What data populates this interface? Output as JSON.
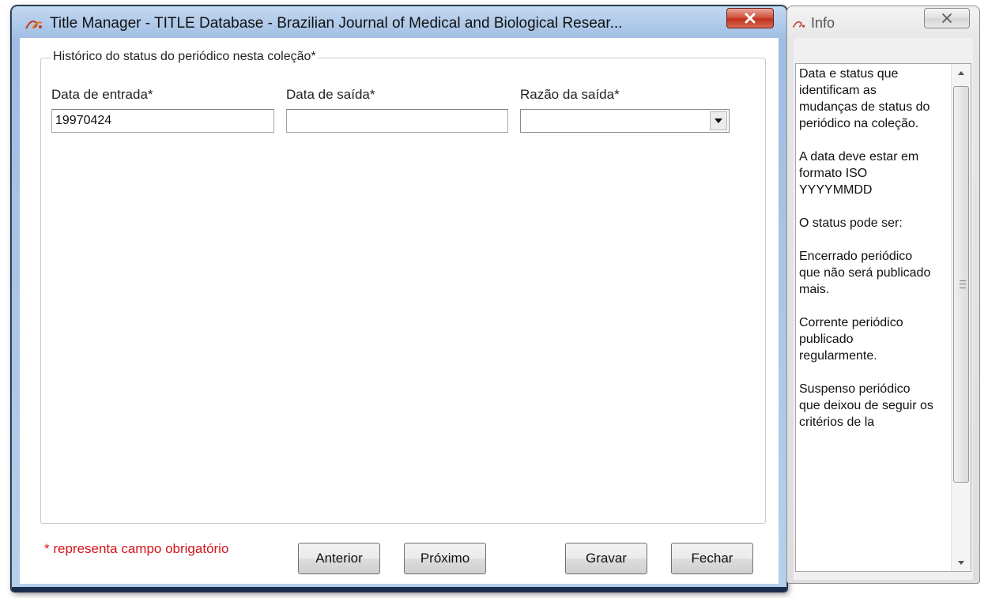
{
  "main_window": {
    "title": "Title Manager - TITLE Database - Brazilian Journal of Medical and Biological Resear...",
    "app_icon": "scielo-logo-icon",
    "close_icon": "close-icon"
  },
  "form": {
    "group_title": "Histórico do status do periódico nesta coleção*",
    "entry_date": {
      "label": "Data de entrada*",
      "value": "19970424",
      "placeholder": ""
    },
    "exit_date": {
      "label": "Data de saída*",
      "value": "",
      "placeholder": ""
    },
    "exit_reason": {
      "label": "Razão da saída*",
      "selected": "",
      "icon": "chevron-down-icon"
    },
    "required_note": "* representa campo obrigatório"
  },
  "buttons": {
    "previous": "Anterior",
    "next": "Próximo",
    "save": "Gravar",
    "close": "Fechar"
  },
  "info_window": {
    "title": "Info",
    "paragraphs": [
      "Data e status que identificam as mudanças de status do periódico na coleção.",
      "A data deve estar em formato ISO YYYYMMDD",
      "O status pode ser:",
      "Encerrado periódico que não será publicado mais.",
      "Corrente periódico publicado regularmente.",
      "Suspenso periódico que deixou de seguir os critérios de la"
    ]
  },
  "colors": {
    "required_text": "#d4141b",
    "close_button": "#c1311b",
    "frame": "#a9c4e6"
  }
}
